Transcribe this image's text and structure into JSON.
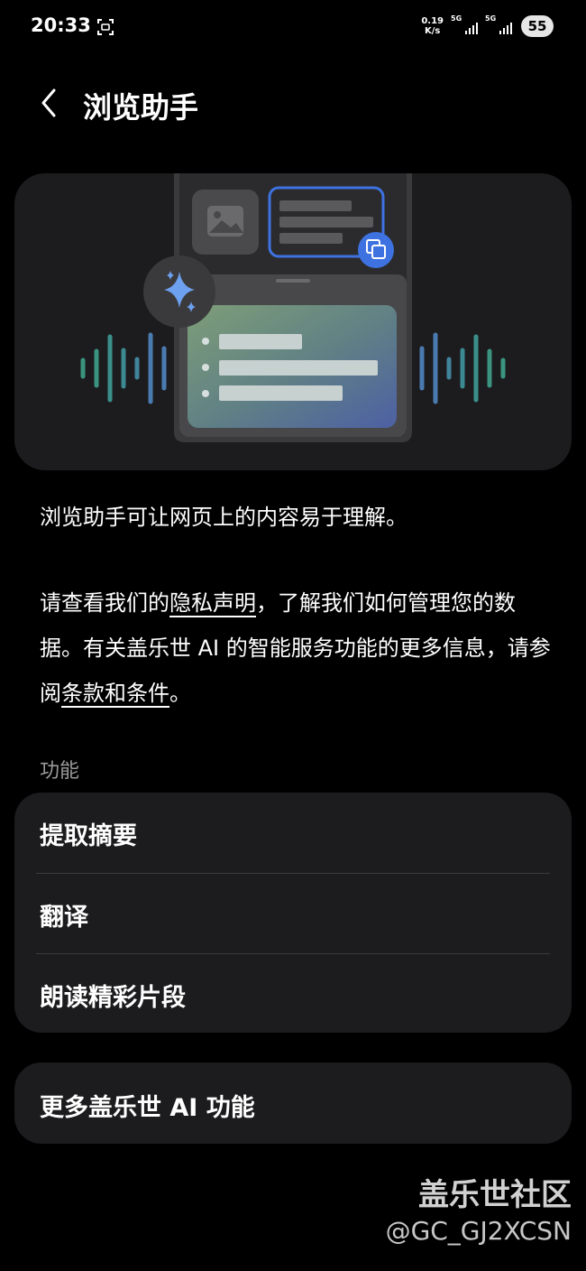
{
  "status_bar": {
    "time": "20:33",
    "net_speed_value": "0.19",
    "net_speed_unit": "K/s",
    "signal1_label": "5G",
    "signal2_label": "5G",
    "battery": "55"
  },
  "header": {
    "title": "浏览助手"
  },
  "description": {
    "intro": "浏览助手可让网页上的内容易于理解。",
    "privacy_prefix": "请查看我们的",
    "privacy_link": "隐私声明",
    "privacy_middle": "，了解我们如何管理您的数据。有关盖乐世 AI 的智能服务功能的更多信息，请参阅",
    "terms_link": "条款和条件",
    "privacy_suffix": "。"
  },
  "features": {
    "section_label": "功能",
    "items": [
      {
        "label": "提取摘要"
      },
      {
        "label": "翻译"
      },
      {
        "label": "朗读精彩片段"
      }
    ]
  },
  "more": {
    "label": "更多盖乐世 AI 功能"
  },
  "watermark": {
    "title": "盖乐世社区",
    "user": "@GC_GJ2XCSN"
  },
  "colors": {
    "background": "#000000",
    "card": "#1c1c1e",
    "accent_blue": "#3d72e0",
    "wave_blue": "#4a7bb0",
    "wave_green": "#3a9480"
  }
}
